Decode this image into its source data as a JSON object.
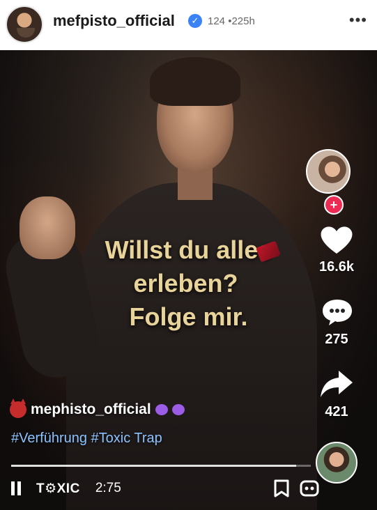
{
  "header": {
    "username": "mefpisto_official",
    "verified_glyph": "✓",
    "stats": "124 •225h",
    "more_glyph": "•••"
  },
  "video": {
    "caption_lines": [
      "Willst du alles",
      "erleben?",
      "Folge mir."
    ],
    "caption_color": "#e8d49a"
  },
  "rail": {
    "follow_glyph": "+",
    "likes": "16.6k",
    "comments": "275",
    "shares": "421"
  },
  "post": {
    "handle": "mephisto_official",
    "hashtags": "#Verführung #Toxic Trap",
    "hashtag_color": "#8cc3ff",
    "progress_fraction": 0.95
  },
  "controls": {
    "brand": "T⚙XIC",
    "time": "2:75"
  },
  "icons": {
    "like": "heart-icon",
    "comment": "comment-bubble-icon",
    "share": "share-arrow-icon",
    "save": "bookmark-icon",
    "more": "more-options-icon"
  }
}
